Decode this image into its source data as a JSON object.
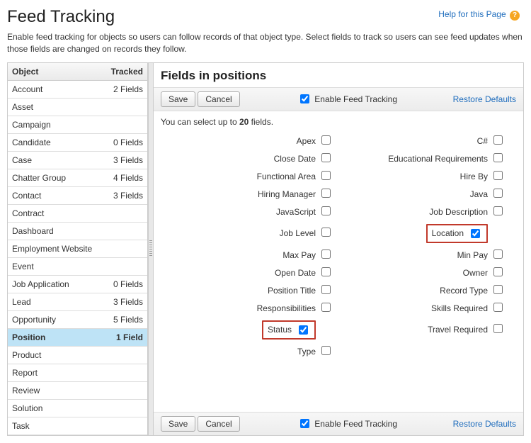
{
  "header": {
    "title": "Feed Tracking",
    "help_text": "Help for this Page",
    "intro": "Enable feed tracking for objects so users can follow records of that object type. Select fields to track so users can see feed updates when those fields are changed on records they follow."
  },
  "object_table": {
    "col_object": "Object",
    "col_tracked": "Tracked",
    "rows": [
      {
        "name": "Account",
        "tracked": "2 Fields",
        "link": false
      },
      {
        "name": "Asset",
        "tracked": "",
        "link": false
      },
      {
        "name": "Campaign",
        "tracked": "",
        "link": false
      },
      {
        "name": "Candidate",
        "tracked": "0 Fields",
        "link": false
      },
      {
        "name": "Case",
        "tracked": "3 Fields",
        "link": false
      },
      {
        "name": "Chatter Group",
        "tracked": "4 Fields",
        "link": false
      },
      {
        "name": "Contact",
        "tracked": "3 Fields",
        "link": false
      },
      {
        "name": "Contract",
        "tracked": "",
        "link": false
      },
      {
        "name": "Dashboard",
        "tracked": "",
        "link": false
      },
      {
        "name": "Employment Website",
        "tracked": "",
        "link": false
      },
      {
        "name": "Event",
        "tracked": "",
        "link": false
      },
      {
        "name": "Job Application",
        "tracked": "0 Fields",
        "link": false
      },
      {
        "name": "Lead",
        "tracked": "3 Fields",
        "link": false
      },
      {
        "name": "Opportunity",
        "tracked": "5 Fields",
        "link": false
      },
      {
        "name": "Position",
        "tracked": "1 Field",
        "link": false,
        "selected": true
      },
      {
        "name": "Product",
        "tracked": "",
        "link": false
      },
      {
        "name": "Report",
        "tracked": "",
        "link": false
      },
      {
        "name": "Review",
        "tracked": "",
        "link": false
      },
      {
        "name": "Solution",
        "tracked": "",
        "link": false
      },
      {
        "name": "Task",
        "tracked": "",
        "link": false
      }
    ]
  },
  "panel": {
    "title": "Fields in positions",
    "save_label": "Save",
    "cancel_label": "Cancel",
    "enable_label": "Enable Feed Tracking",
    "enable_checked": true,
    "restore_label": "Restore Defaults",
    "select_note_prefix": "You can select up to ",
    "select_note_count": "20",
    "select_note_suffix": " fields."
  },
  "fields": {
    "left": [
      {
        "label": "Apex",
        "checked": false
      },
      {
        "label": "Close Date",
        "checked": false
      },
      {
        "label": "Functional Area",
        "checked": false
      },
      {
        "label": "Hiring Manager",
        "checked": false
      },
      {
        "label": "JavaScript",
        "checked": false
      },
      {
        "label": "Job Level",
        "checked": false
      },
      {
        "label": "Max Pay",
        "checked": false
      },
      {
        "label": "Open Date",
        "checked": false
      },
      {
        "label": "Position Title",
        "checked": false
      },
      {
        "label": "Responsibilities",
        "checked": false
      },
      {
        "label": "Status",
        "checked": true,
        "highlight": true
      },
      {
        "label": "Type",
        "checked": false
      }
    ],
    "right": [
      {
        "label": "C#",
        "checked": false
      },
      {
        "label": "Educational Requirements",
        "checked": false
      },
      {
        "label": "Hire By",
        "checked": false
      },
      {
        "label": "Java",
        "checked": false
      },
      {
        "label": "Job Description",
        "checked": false
      },
      {
        "label": "Location",
        "checked": true,
        "highlight": true
      },
      {
        "label": "Min Pay",
        "checked": false
      },
      {
        "label": "Owner",
        "checked": false
      },
      {
        "label": "Record Type",
        "checked": false
      },
      {
        "label": "Skills Required",
        "checked": false
      },
      {
        "label": "Travel Required",
        "checked": false
      },
      {
        "label": "",
        "checked": null
      }
    ]
  }
}
